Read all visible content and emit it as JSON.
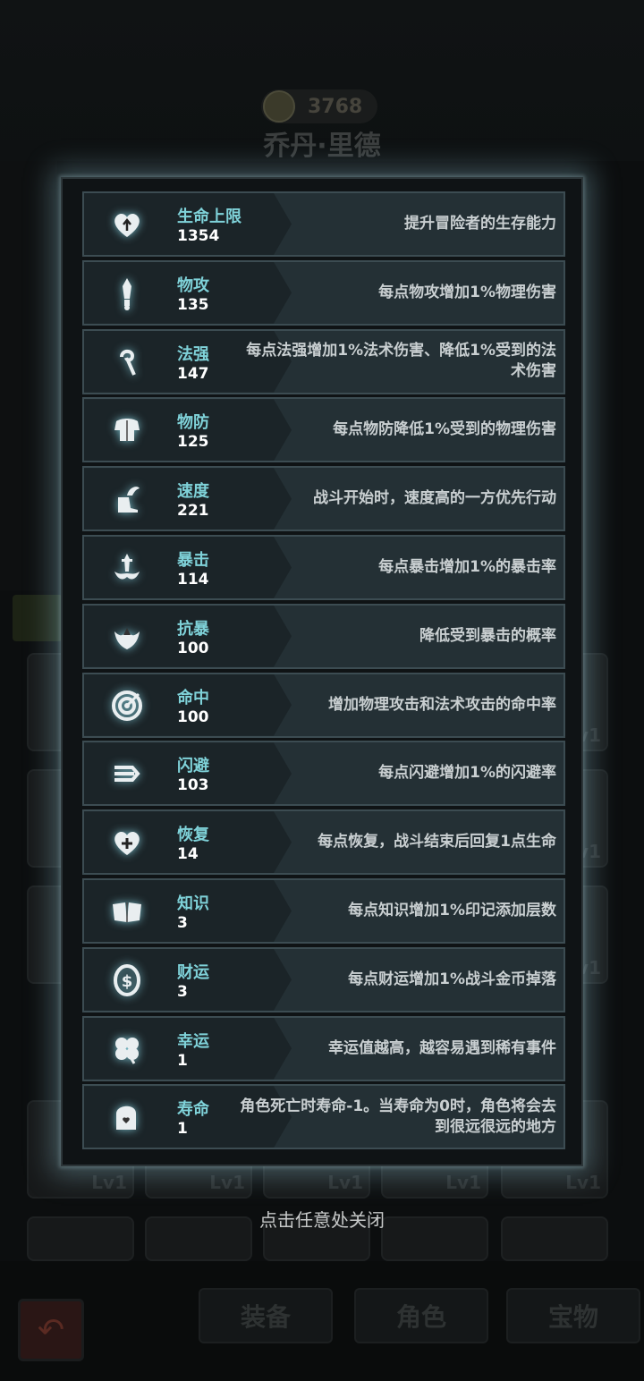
{
  "background": {
    "power": "3768",
    "hero_name": "乔丹·里德",
    "slot_level": "Lv1",
    "tabs": [
      "装备",
      "角色",
      "宝物"
    ]
  },
  "stats": [
    {
      "name": "生命上限",
      "value": "1354",
      "desc": "提升冒险者的生存能力",
      "icon": "heart-arrow-icon"
    },
    {
      "name": "物攻",
      "value": "135",
      "desc": "每点物攻增加1%物理伤害",
      "icon": "sword-icon"
    },
    {
      "name": "法强",
      "value": "147",
      "desc": "每点法强增加1%法术伤害、降低1%受到的法术伤害",
      "icon": "staff-icon"
    },
    {
      "name": "物防",
      "value": "125",
      "desc": "每点物防降低1%受到的物理伤害",
      "icon": "armor-icon"
    },
    {
      "name": "速度",
      "value": "221",
      "desc": "战斗开始时，速度高的一方优先行动",
      "icon": "winged-boot-icon"
    },
    {
      "name": "暴击",
      "value": "114",
      "desc": "每点暴击增加1%的暴击率",
      "icon": "crit-sword-icon"
    },
    {
      "name": "抗暴",
      "value": "100",
      "desc": "降低受到暴击的概率",
      "icon": "crit-resist-icon"
    },
    {
      "name": "命中",
      "value": "100",
      "desc": "增加物理攻击和法术攻击的命中率",
      "icon": "target-icon"
    },
    {
      "name": "闪避",
      "value": "103",
      "desc": "每点闪避增加1%的闪避率",
      "icon": "dodge-arrows-icon"
    },
    {
      "name": "恢复",
      "value": "14",
      "desc": "每点恢复，战斗结束后回复1点生命",
      "icon": "heart-plus-icon"
    },
    {
      "name": "知识",
      "value": "3",
      "desc": "每点知识增加1%印记添加层数",
      "icon": "book-icon"
    },
    {
      "name": "财运",
      "value": "3",
      "desc": "每点财运增加1%战斗金币掉落",
      "icon": "coin-icon"
    },
    {
      "name": "幸运",
      "value": "1",
      "desc": "幸运值越高，越容易遇到稀有事件",
      "icon": "clover-icon"
    },
    {
      "name": "寿命",
      "value": "1",
      "desc": "角色死亡时寿命-1。当寿命为0时，角色将会去到很远很远的地方",
      "icon": "tombstone-icon"
    }
  ],
  "close_hint": "点击任意处关闭"
}
